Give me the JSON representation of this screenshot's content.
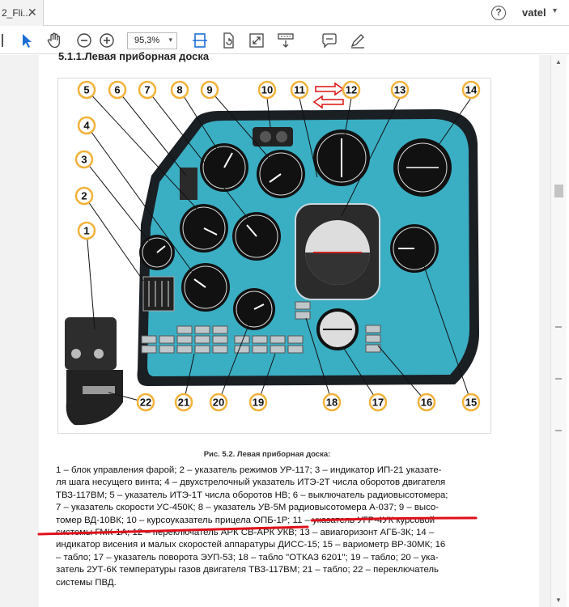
{
  "tab": {
    "title": "2_Fli...",
    "close_glyph": "✕"
  },
  "header": {
    "help_glyph": "?",
    "user_name": "vatel",
    "user_caret": "▾"
  },
  "toolbar": {
    "zoom_value": "95,3%",
    "zoom_caret": "▾",
    "icons": [
      "cursor-icon",
      "hand-icon",
      "zoom-out-icon",
      "zoom-in-icon",
      "fit-page-icon",
      "rotate-icon",
      "fullscreen-icon",
      "read-mode-icon",
      "comment-icon",
      "pen-icon"
    ]
  },
  "document": {
    "section_title": "5.1.1.Левая приборная доска",
    "caption": "Рис. 5.2. Левая приборная доска:",
    "lines": [
      "1 – блок управления фарой; 2 – указатель режимов УР-117; 3 – индикатор ИП-21 указате-",
      "ля шага несущего винта; 4 – двухстрелочный указатель ИТЭ-2Т числа оборотов двигателя",
      "ТВЗ-117ВМ; 5 – указатель ИТЭ-1Т числа оборотов НВ; 6 – выключатель радиовысотомера;",
      "7 – указатель скорости УС-450К; 8 – указатель УВ-5М радиовысотомера А-037; 9 – высо-",
      "томер ВД-10ВК; 10 – курсоуказатель прицела ОПБ-1Р; 11 – указатель УГР-4УК курсовой",
      "системы ГМК-1А; 12 – переключатель АРК СВ-АРК УКВ; 13 – авиагоризонт АГБ-3К; 14 –",
      "индикатор висения и малых скоростей аппаратуры ДИСС-15; 15 – вариометр ВР-30МК; 16",
      "– табло; 17 – указатель поворота ЭУП-53; 18 – табло \"ОТКАЗ 6201\"; 19 – табло; 20 – ука-",
      "затель 2УТ-6К температуры газов двигателя ТВЗ-117ВМ; 21 – табло; 22 – переключатель",
      "системы ПВД."
    ],
    "underline_color": "#e0101a"
  },
  "figure": {
    "panel_color": "#3aaec3",
    "frame_color": "#1a1f24",
    "callout_color": "#f2b23a",
    "callouts": [
      {
        "n": "1"
      },
      {
        "n": "2"
      },
      {
        "n": "3"
      },
      {
        "n": "4"
      },
      {
        "n": "5"
      },
      {
        "n": "6"
      },
      {
        "n": "7"
      },
      {
        "n": "8"
      },
      {
        "n": "9"
      },
      {
        "n": "10"
      },
      {
        "n": "11"
      },
      {
        "n": "12"
      },
      {
        "n": "13"
      },
      {
        "n": "14"
      },
      {
        "n": "15"
      },
      {
        "n": "16"
      },
      {
        "n": "17"
      },
      {
        "n": "18"
      },
      {
        "n": "19"
      },
      {
        "n": "20"
      },
      {
        "n": "21"
      },
      {
        "n": "22"
      }
    ]
  }
}
